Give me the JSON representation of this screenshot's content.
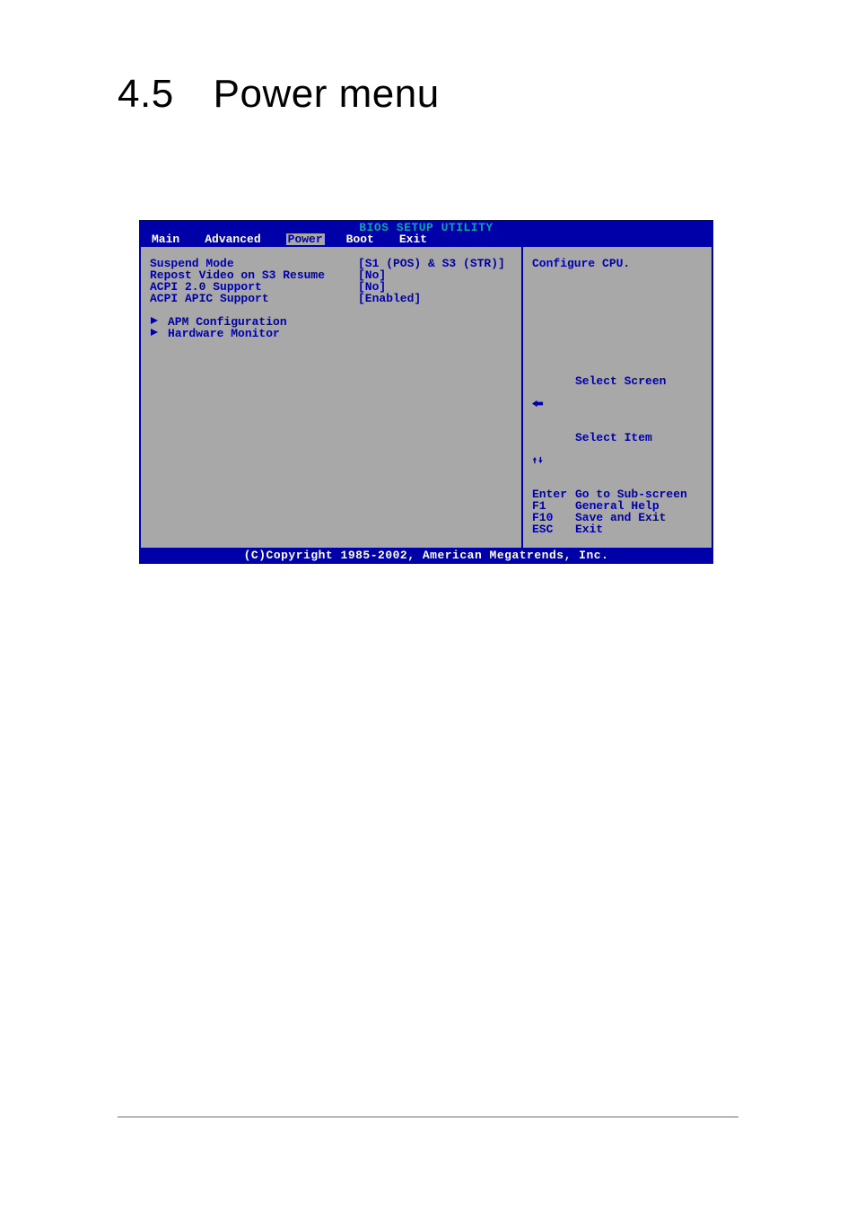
{
  "page": {
    "section_number": "4.5",
    "section_title": "Power menu"
  },
  "bios": {
    "title": "BIOS SETUP UTILITY",
    "tabs": [
      "Main",
      "Advanced",
      "Power",
      "Boot",
      "Exit"
    ],
    "active_tab": "Power",
    "items": [
      {
        "label": "Suspend Mode",
        "value": "[S1 (POS) & S3 (STR)]"
      },
      {
        "label": "Repost Video on S3 Resume",
        "value": "[No]"
      },
      {
        "label": "ACPI 2.0 Support",
        "value": "[No]"
      },
      {
        "label": "ACPI APIC Support",
        "value": "[Enabled]"
      }
    ],
    "submenus": [
      "APM Configuration",
      "Hardware Monitor"
    ],
    "help": "Configure CPU.",
    "keys": [
      {
        "key_icon": "arrow-left",
        "key": "",
        "action": "Select Screen"
      },
      {
        "key_icon": "arrow-updown",
        "key": "",
        "action": "Select Item"
      },
      {
        "key_icon": "",
        "key": "Enter",
        "action": "Go to Sub-screen"
      },
      {
        "key_icon": "",
        "key": "F1",
        "action": "General Help"
      },
      {
        "key_icon": "",
        "key": "F10",
        "action": "Save and Exit"
      },
      {
        "key_icon": "",
        "key": "ESC",
        "action": "Exit"
      }
    ],
    "footer": "(C)Copyright 1985-2002, American Megatrends, Inc."
  }
}
